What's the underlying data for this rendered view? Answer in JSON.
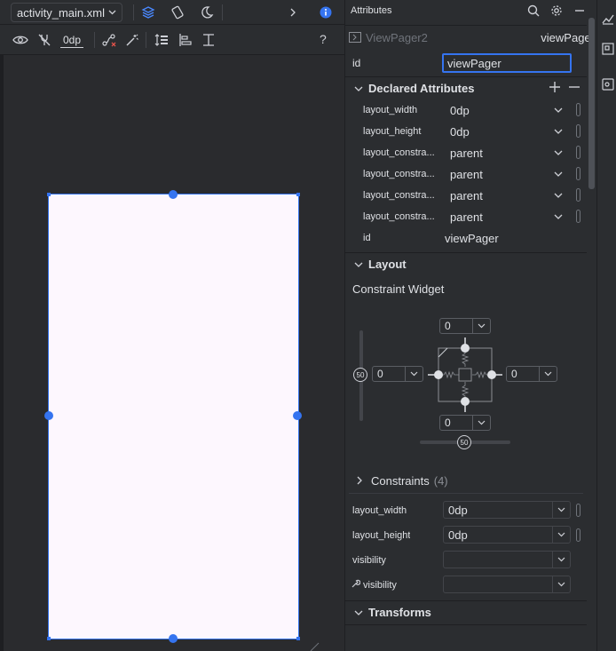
{
  "toolbar": {
    "file_name": "activity_main.xml",
    "default_margin": "0dp",
    "help": "?"
  },
  "attributes": {
    "panel_title": "Attributes",
    "component_type": "ViewPager2",
    "component_name": "viewPager",
    "id_label": "id",
    "id_value": "viewPager",
    "declared": {
      "title": "Declared Attributes",
      "rows": [
        {
          "name": "layout_width",
          "value": "0dp"
        },
        {
          "name": "layout_height",
          "value": "0dp"
        },
        {
          "name": "layout_constra...",
          "value": "parent"
        },
        {
          "name": "layout_constra...",
          "value": "parent"
        },
        {
          "name": "layout_constra...",
          "value": "parent"
        },
        {
          "name": "layout_constra...",
          "value": "parent"
        },
        {
          "name": "id",
          "value": "viewPager"
        }
      ]
    },
    "layout": {
      "title": "Layout",
      "widget_title": "Constraint Widget",
      "margin_top": "0",
      "margin_left": "0",
      "margin_right": "0",
      "margin_bottom": "0",
      "vertical_bias": "50",
      "horizontal_bias": "50"
    },
    "constraints": {
      "title": "Constraints",
      "count": "(4)"
    },
    "props": [
      {
        "name": "layout_width",
        "value": "0dp"
      },
      {
        "name": "layout_height",
        "value": "0dp"
      },
      {
        "name": "visibility",
        "value": ""
      },
      {
        "name": "visibility",
        "value": ""
      }
    ],
    "transforms": {
      "title": "Transforms"
    }
  },
  "colors": {
    "accent": "#3574f0",
    "background": "#2b2d30",
    "phone_surface": "#fdf7fe"
  }
}
